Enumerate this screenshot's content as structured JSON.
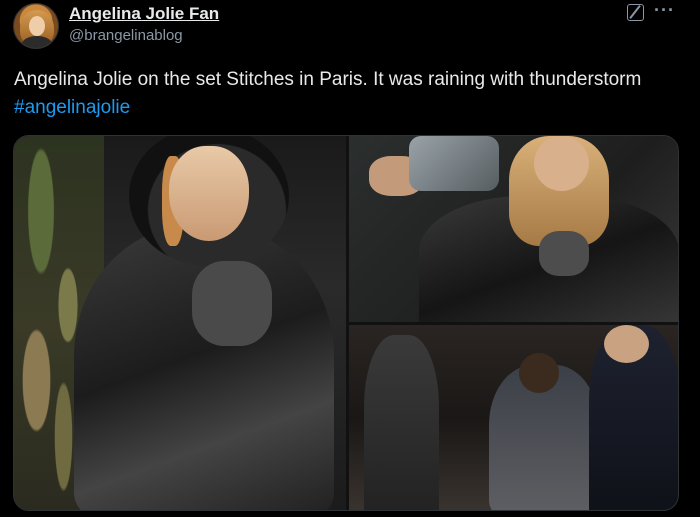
{
  "post": {
    "author_name": "Angelina Jolie Fan",
    "author_handle": "@brangelinablog",
    "text": "Angelina Jolie on the set Stitches in Paris. It was raining with thunderstorm ",
    "hashtag": "#angelinajolie"
  },
  "icons": {
    "grok": "grok-icon",
    "more": "more-icon"
  },
  "colors": {
    "background": "#000000",
    "text_primary": "#e7e9ea",
    "text_secondary": "#8b98a5",
    "link": "#1d9bf0"
  },
  "media": {
    "photo_count": 3
  }
}
